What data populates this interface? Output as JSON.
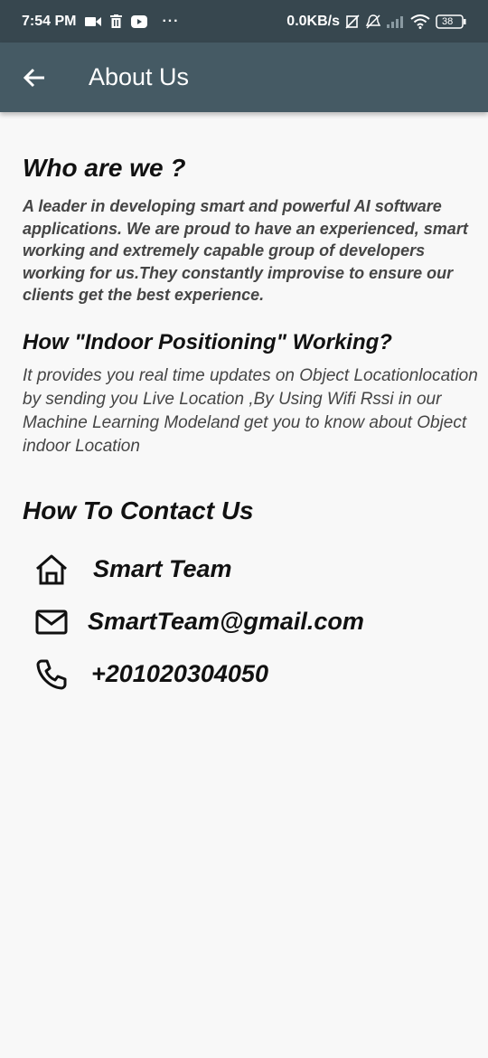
{
  "status_bar": {
    "time": "7:54 PM",
    "dots": "···",
    "network_speed": "0.0KB/s",
    "battery": "38"
  },
  "app_bar": {
    "back_icon": "arrow-left-icon",
    "title": "About Us"
  },
  "about": {
    "heading": "Who are we ?",
    "body": "A leader in developing smart and powerful AI software applications. We are proud to have an experienced, smart working and extremely capable group of developers working for us.They constantly improvise to ensure our clients get the best experience."
  },
  "how_it_works": {
    "heading": "How \"Indoor Positioning\" Working?",
    "body": "It provides you real time updates on Object Locationlocation by sending you Live Location ,By Using Wifi Rssi in our Machine Learning Modeland get you to know about Object indoor Location"
  },
  "contact": {
    "heading": "How To Contact Us",
    "items": [
      {
        "icon": "home-icon",
        "text": "Smart Team"
      },
      {
        "icon": "mail-icon",
        "text": "SmartTeam@gmail.com"
      },
      {
        "icon": "phone-icon",
        "text": "+201020304050"
      }
    ]
  },
  "colors": {
    "status_bar": "#37474f",
    "app_bar": "#455a64",
    "background": "#f8f8f8"
  }
}
